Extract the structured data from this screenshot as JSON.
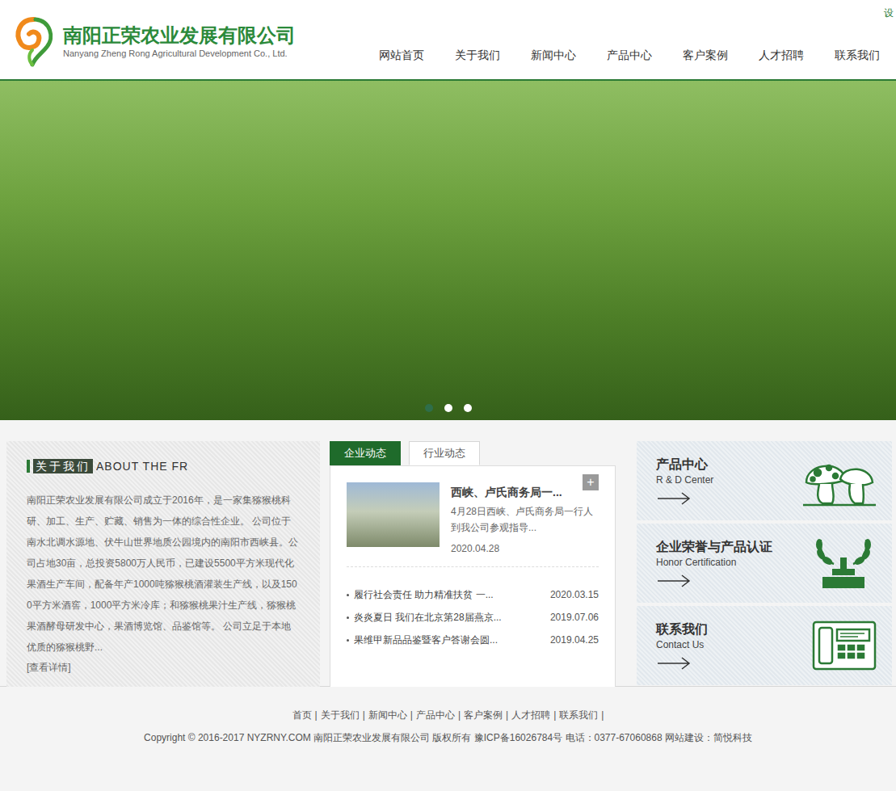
{
  "header": {
    "logo_name": "南阳正荣农业发展有限公司",
    "logo_english": "Nanyang Zheng Rong Agricultural Development Co., Ltd.",
    "corner_text": "设"
  },
  "nav": [
    {
      "label": "网站首页"
    },
    {
      "label": "关于我们"
    },
    {
      "label": "新闻中心"
    },
    {
      "label": "产品中心"
    },
    {
      "label": "客户案例"
    },
    {
      "label": "人才招聘"
    },
    {
      "label": "联系我们"
    }
  ],
  "banner": {
    "dots": [
      {
        "selected": true
      },
      {
        "selected": false
      },
      {
        "selected": false
      }
    ]
  },
  "about": {
    "title": "关于我们",
    "subtitle": "ABOUT THE FR",
    "text": "南阳正荣农业发展有限公司成立于2016年，是一家集猕猴桃科研、加工、生产、贮藏、销售为一体的综合性企业。 公司位于南水北调水源地、伏牛山世界地质公园境内的南阳市西峡县。公司占地30亩，总投资5800万人民币，已建设5500平方米现代化果酒生产车间，配备年产1000吨猕猴桃酒灌装生产线，以及1500平方米酒窖，1000平方米冷库；和猕猴桃果汁生产线，猕猴桃果酒酵母研发中心，果酒博览馆、品鉴馆等。 公司立足于本地优质的猕猴桃野...",
    "more": "[查看详情]"
  },
  "news": {
    "tabs": [
      {
        "label": "企业动态",
        "selected": true
      },
      {
        "label": "行业动态",
        "selected": false
      }
    ],
    "featured": {
      "title": "西峡、卢氏商务局一...",
      "summary": "4月28日西峡、卢氏商务局一行人到我公司参观指导...",
      "date": "2020.04.28",
      "more": "+"
    },
    "items": [
      {
        "title": "履行社会责任 助力精准扶贫 一...",
        "date": "2020.03.15"
      },
      {
        "title": "炎炎夏日 我们在北京第28届燕京...",
        "date": "2019.07.06"
      },
      {
        "title": "果维甲新品品鉴暨客户答谢会圆...",
        "date": "2019.04.25"
      }
    ]
  },
  "cards": [
    {
      "title": "产品中心",
      "subtitle": "R & D Center",
      "kind": "mushroom"
    },
    {
      "title": "企业荣誉与产品认证",
      "subtitle": "Honor Certification",
      "kind": "trophy"
    },
    {
      "title": "联系我们",
      "subtitle": "Contact Us",
      "kind": "phone"
    }
  ],
  "footer": {
    "links": [
      "首页",
      "关于我们",
      "新闻中心",
      "产品中心",
      "客户案例",
      "人才招聘",
      "联系我们"
    ],
    "separator": "|",
    "copyright": "Copyright © 2016-2017 NYZRNY.COM 南阳正荣农业发展有限公司 版权所有 豫ICP备16026784号 电话：0377-67060868 网站建设：简悦科技"
  }
}
